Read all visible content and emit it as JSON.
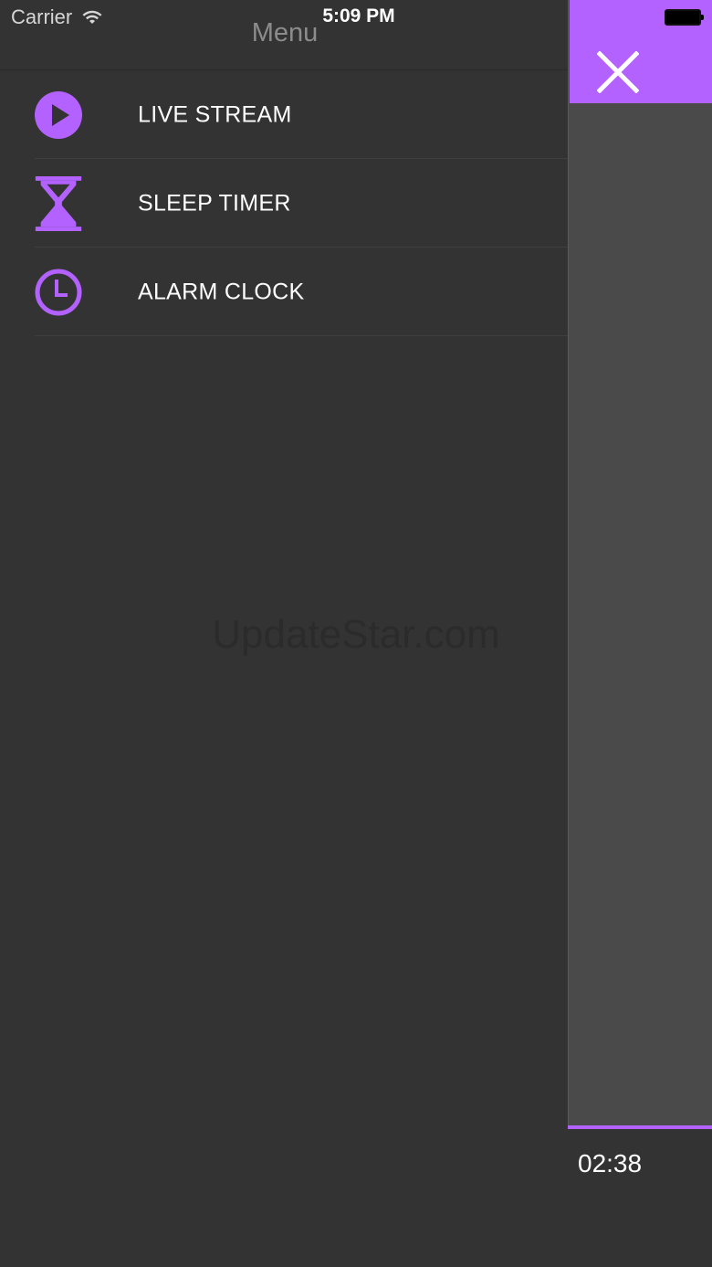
{
  "status_bar": {
    "carrier": "Carrier",
    "time": "5:09 PM"
  },
  "menu": {
    "title": "Menu",
    "items": [
      {
        "label": "LIVE STREAM",
        "icon": "play-icon"
      },
      {
        "label": "SLEEP TIMER",
        "icon": "hourglass-icon"
      },
      {
        "label": "ALARM CLOCK",
        "icon": "clock-icon"
      }
    ]
  },
  "watermark": "UpdateStar.com",
  "player": {
    "elapsed": "02:38",
    "progress": 1.0,
    "close_icon": "close-icon"
  },
  "colors": {
    "accent": "#b462ff",
    "background": "#333333",
    "panel": "#4a4a4a",
    "text": "#ffffff"
  }
}
